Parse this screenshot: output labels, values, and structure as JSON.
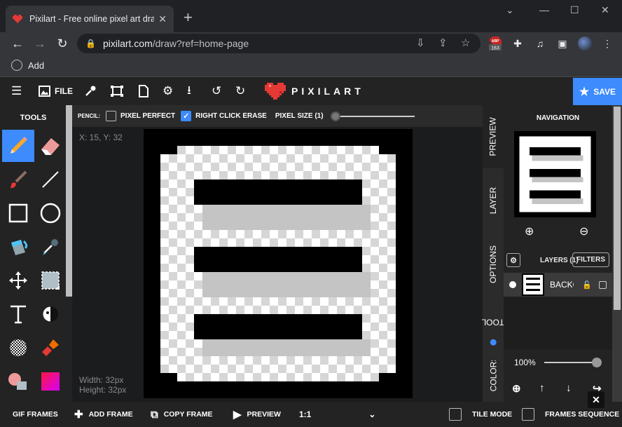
{
  "browser": {
    "tab_title": "Pixilart - Free online pixel art drawing",
    "url_domain": "pixilart.com",
    "url_path": "/draw?ref=home-page",
    "bookmark_label": "Add",
    "extension_badge": "163"
  },
  "header": {
    "file_label": "FILE",
    "logo_text": "PIXILART",
    "save_label": "SAVE"
  },
  "tools": {
    "title": "TOOLS"
  },
  "options": {
    "tool_name": "PENCIL:",
    "pixel_perfect_label": "PIXEL PERFECT",
    "pixel_perfect_checked": false,
    "right_click_erase_label": "RIGHT CLICK ERASE",
    "right_click_erase_checked": true,
    "pixel_size_label": "PIXEL SIZE (1)"
  },
  "canvas": {
    "coords": "X: 15, Y: 32",
    "width_label": "Width: 32px",
    "height_label": "Height: 32px"
  },
  "right_panel": {
    "vtabs": [
      "PREVIEW",
      "LAYER",
      "OPTIONS",
      "TOOL",
      "COLORS"
    ],
    "navigation_title": "NAVIGATION",
    "layers_label": "LAYERS (1)",
    "filters_label": "FILTERS",
    "layer_name": "BACKGROUND",
    "zoom_value": "100%"
  },
  "bottom": {
    "gif_frames": "GIF FRAMES",
    "add_frame": "ADD FRAME",
    "copy_frame": "COPY FRAME",
    "preview": "PREVIEW",
    "ratio": "1:1",
    "tile_mode": "TILE MODE",
    "frames_sequence": "FRAMES SEQUENCE"
  },
  "colors": {
    "accent": "#3d8bfd",
    "background": "#232323"
  }
}
